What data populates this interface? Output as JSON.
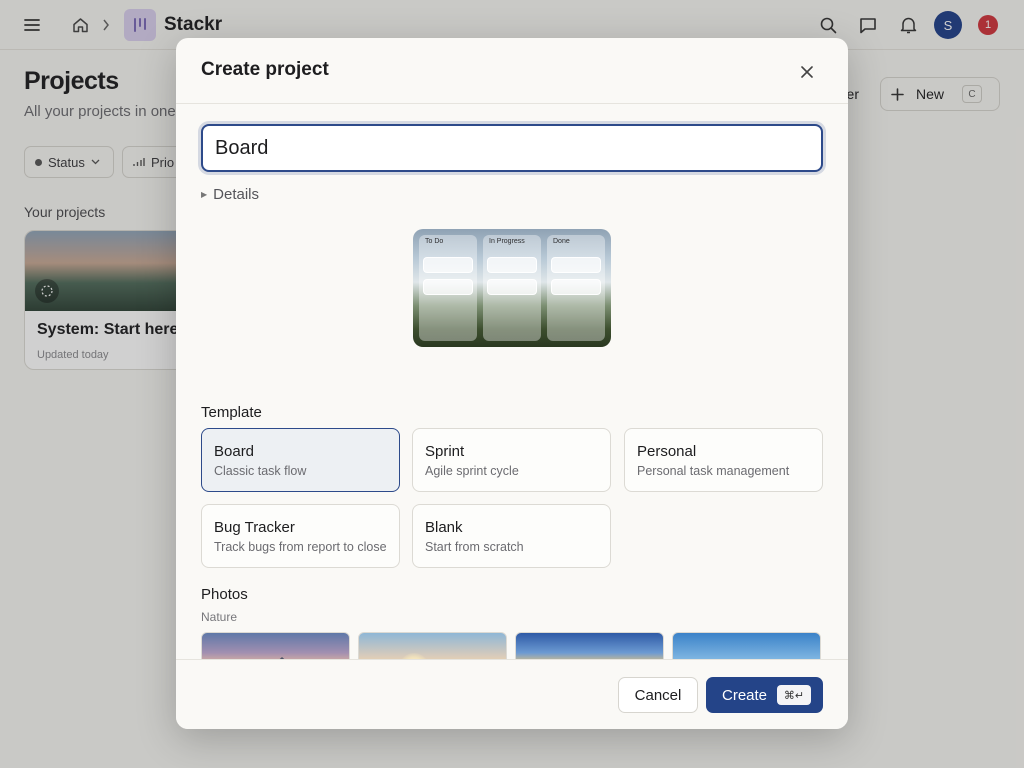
{
  "app": {
    "name": "Stackr"
  },
  "topbar": {
    "avatar_initial": "S",
    "notification_count": "1"
  },
  "page": {
    "title": "Projects",
    "subtitle": "All your projects in one p",
    "filters": [
      {
        "label": "Status"
      },
      {
        "label": "Prio"
      }
    ],
    "section_label": "Your projects",
    "project_card": {
      "title": "System: Start here",
      "updated": "Updated today"
    },
    "partial_button_label": "er",
    "new_button": {
      "label": "New",
      "shortcut": "C"
    }
  },
  "modal": {
    "title": "Create project",
    "name_input": {
      "value": "Board"
    },
    "details_label": "Details",
    "preview": {
      "columns": [
        "To Do",
        "In Progress",
        "Done"
      ]
    },
    "template_section_title": "Template",
    "templates": [
      {
        "name": "Board",
        "description": "Classic task flow",
        "selected": true
      },
      {
        "name": "Sprint",
        "description": "Agile sprint cycle",
        "selected": false
      },
      {
        "name": "Personal",
        "description": "Personal task management",
        "selected": false
      },
      {
        "name": "Bug Tracker",
        "description": "Track bugs from report to close",
        "selected": false
      },
      {
        "name": "Blank",
        "description": "Start from scratch",
        "selected": false
      }
    ],
    "photos_section_title": "Photos",
    "photos_subtitle": "Nature",
    "photos": [
      "mountain-snow-photo",
      "ocean-sunset-photo",
      "green-valley-photo",
      "desert-canyon-photo"
    ],
    "footer": {
      "cancel_label": "Cancel",
      "create_label": "Create",
      "create_shortcut": "⌘↵"
    }
  },
  "colors": {
    "accent": "#244488",
    "selected_border": "#2d4a8a",
    "notification": "#d0343b"
  }
}
